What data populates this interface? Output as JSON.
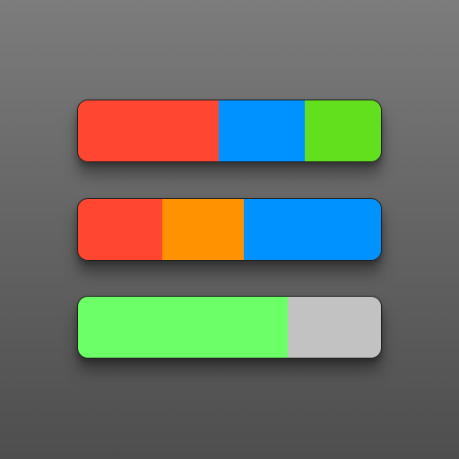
{
  "bars": [
    {
      "name": "top",
      "segments": [
        {
          "color": "#ff4630",
          "share": 0.465
        },
        {
          "color": "#0093ff",
          "share": 0.285
        },
        {
          "color": "#62e01e",
          "share": 0.25
        }
      ]
    },
    {
      "name": "middle",
      "segments": [
        {
          "color": "#ff4630",
          "share": 0.277
        },
        {
          "color": "#ff9200",
          "share": 0.27
        },
        {
          "color": "#0093ff",
          "share": 0.453
        }
      ]
    },
    {
      "name": "bottom",
      "segments": [
        {
          "color": "#6dff68",
          "share": 0.693
        },
        {
          "color": "#c2c2c2",
          "share": 0.307
        }
      ]
    }
  ]
}
